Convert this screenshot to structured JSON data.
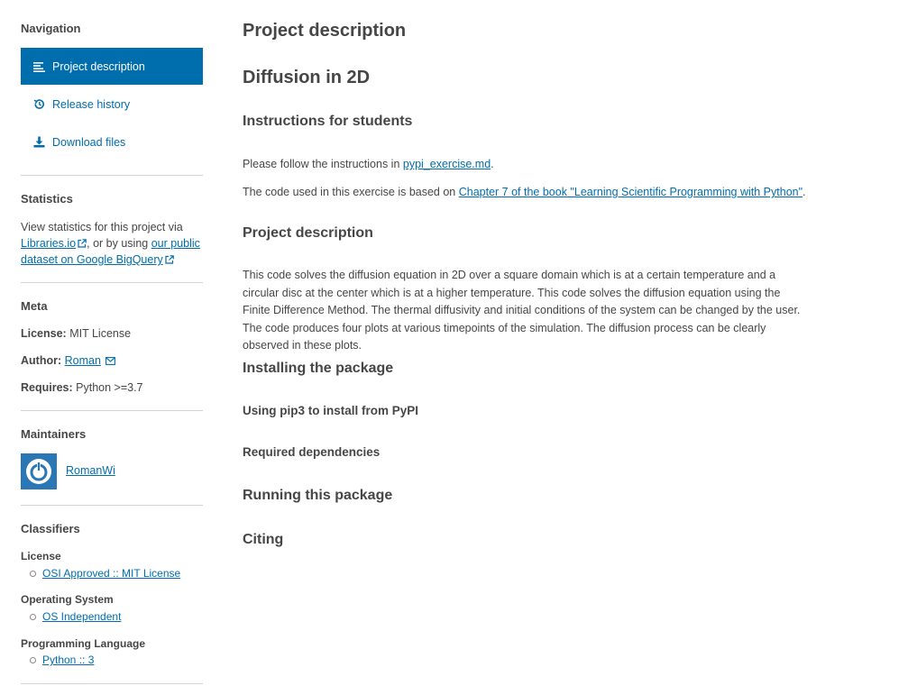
{
  "sidebar": {
    "navigation_heading": "Navigation",
    "nav_items": [
      {
        "label": "Project description"
      },
      {
        "label": "Release history"
      },
      {
        "label": "Download files"
      }
    ],
    "statistics": {
      "heading": "Statistics",
      "text_before": "View statistics for this project via ",
      "link1": "Libraries.io",
      "text_middle": ", or by using ",
      "link2": "our public dataset on Google BigQuery"
    },
    "meta": {
      "heading": "Meta",
      "license_label": "License:",
      "license_value": "MIT License",
      "author_label": "Author:",
      "author_value": "Roman",
      "requires_label": "Requires:",
      "requires_value": "Python >=3.7"
    },
    "maintainers": {
      "heading": "Maintainers",
      "name": "RomanWi"
    },
    "classifiers": {
      "heading": "Classifiers",
      "groups": [
        {
          "title": "License",
          "item": "OSI Approved :: MIT License"
        },
        {
          "title": "Operating System",
          "item": "OS Independent"
        },
        {
          "title": "Programming Language",
          "item": "Python :: 3"
        }
      ]
    }
  },
  "main": {
    "title": "Project description",
    "h_diffusion": "Diffusion in 2D",
    "h_instructions": "Instructions for students",
    "p1_before": "Please follow the instructions in ",
    "p1_link": "pypi_exercise.md",
    "p1_after": ".",
    "p2_before": "The code used in this exercise is based on ",
    "p2_link": "Chapter 7 of the book \"Learning Scientific Programming with Python\"",
    "p2_after": ".",
    "h_project": "Project description",
    "p3": "This code solves the diffusion equation in 2D over a square domain which is at a certain temperature and a circular disc at the center which is at a higher temperature. This code solves the diffusion equation using the Finite Difference Method. The thermal diffusivity and initial conditions of the system can be changed by the user. The code produces four plots at various timepoints of the simulation. The diffusion process can be clearly observed in these plots.",
    "h_installing": "Installing the package",
    "h_pip": "Using pip3 to install from PyPI",
    "h_deps": "Required dependencies",
    "h_running": "Running this package",
    "h_citing": "Citing"
  },
  "colors": {
    "accent": "#006dad",
    "text": "#464646",
    "divider": "#d3d3d3"
  }
}
